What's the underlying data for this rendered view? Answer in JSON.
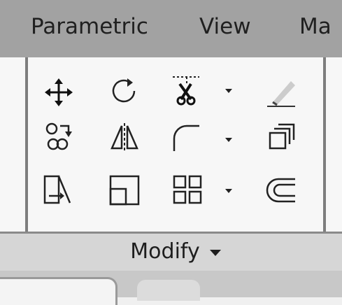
{
  "ribbon": {
    "tabs": [
      {
        "label": "Parametric"
      },
      {
        "label": "View"
      },
      {
        "label": "Ma"
      }
    ]
  },
  "panel": {
    "title": "Modify"
  },
  "tools": [
    {
      "icon": "move-icon"
    },
    {
      "icon": "rotate-icon"
    },
    {
      "icon": "trim-icon"
    },
    {
      "icon": "erase-icon"
    },
    {
      "icon": "copy-icon"
    },
    {
      "icon": "mirror-icon"
    },
    {
      "icon": "fillet-icon"
    },
    {
      "icon": "explode-icon"
    },
    {
      "icon": "stretch-icon"
    },
    {
      "icon": "scale-icon"
    },
    {
      "icon": "array-icon"
    },
    {
      "icon": "offset-icon"
    }
  ]
}
